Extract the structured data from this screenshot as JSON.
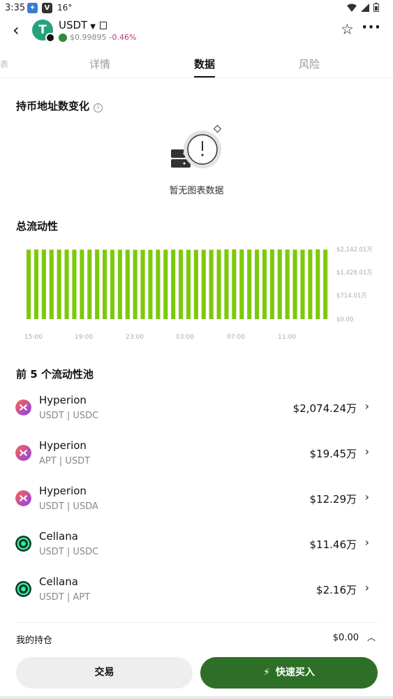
{
  "status": {
    "time": "3:35",
    "temp": "16°",
    "app_badge": "V"
  },
  "header": {
    "token_symbol": "USDT",
    "token_logo_letter": "T",
    "price": "$0.99895",
    "change": "-0.46%"
  },
  "tabs": [
    {
      "label": "详情"
    },
    {
      "label": "数据"
    },
    {
      "label": "风险"
    }
  ],
  "tab_edge": "表",
  "holders_section": {
    "title": "持币地址数变化",
    "empty_text": "暂无图表数据"
  },
  "liquidity_section": {
    "title": "总流动性"
  },
  "chart_data": {
    "type": "bar",
    "title": "",
    "x_tick_labels": [
      "15:00",
      "19:00",
      "23:00",
      "03:00",
      "07:00",
      "11:00"
    ],
    "y_tick_labels": [
      "$2,142.01万",
      "$1,428.01万",
      "$714.01万",
      "$0.00"
    ],
    "ylim": [
      0,
      2142.01
    ],
    "unit": "万",
    "values": [
      2132,
      2135,
      2134,
      2131,
      2133,
      2132,
      2130,
      2131,
      2132,
      2134,
      2130,
      2128,
      2131,
      2130,
      2129,
      2127,
      2128,
      2130,
      2129,
      2131,
      2130,
      2128,
      2127,
      2129,
      2130,
      2131,
      2140,
      2138,
      2136,
      2134,
      2133,
      2135,
      2137,
      2136,
      2134,
      2132,
      2131,
      2134,
      2138,
      2133
    ],
    "bar_color": "#7dc90b",
    "grid": false
  },
  "pools_section": {
    "title": "前 5 个流动性池",
    "pools": [
      {
        "name": "Hyperion",
        "pair": "USDT | USDC",
        "value": "$2,074.24万",
        "logo": "hyperion"
      },
      {
        "name": "Hyperion",
        "pair": "APT | USDT",
        "value": "$19.45万",
        "logo": "hyperion"
      },
      {
        "name": "Hyperion",
        "pair": "USDT | USDA",
        "value": "$12.29万",
        "logo": "hyperion"
      },
      {
        "name": "Cellana",
        "pair": "USDT | USDC",
        "value": "$11.46万",
        "logo": "cellana"
      },
      {
        "name": "Cellana",
        "pair": "USDT | APT",
        "value": "$2.16万",
        "logo": "cellana"
      }
    ]
  },
  "holdings": {
    "label": "我的持仓",
    "amount": "$0.00"
  },
  "actions": {
    "trade": "交易",
    "quick_buy": "快速买入"
  },
  "colors": {
    "accent_green": "#2d6f26",
    "bar_green": "#7dc90b",
    "negative": "#c0367a",
    "tether": "#26a17b"
  }
}
